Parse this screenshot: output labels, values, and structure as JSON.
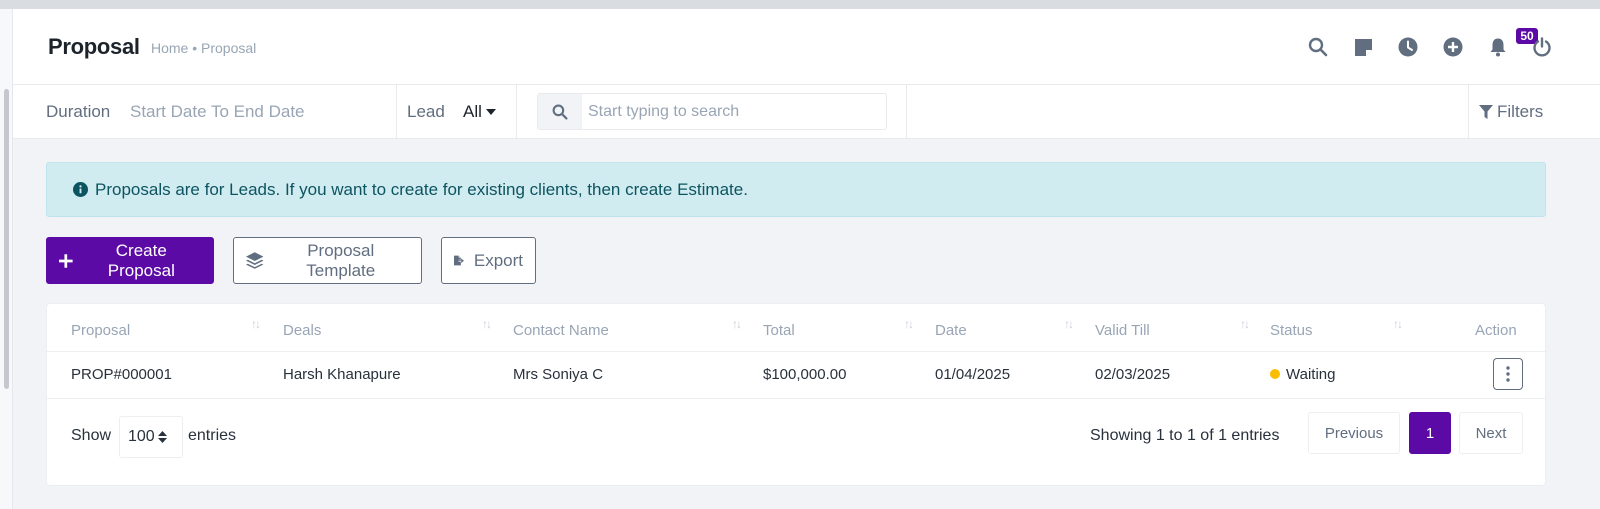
{
  "header": {
    "title": "Proposal",
    "breadcrumb": "Home • Proposal",
    "notification_count": "50"
  },
  "filters": {
    "duration_label": "Duration",
    "duration_value": "Start Date To End Date",
    "lead_label": "Lead",
    "lead_value": "All",
    "search_placeholder": "Start typing to search",
    "filters_label": "Filters"
  },
  "alert": {
    "text": "Proposals are for Leads. If you want to create for existing clients, then create Estimate."
  },
  "actions": {
    "create_label": "Create Proposal",
    "template_label": "Proposal Template",
    "export_label": "Export"
  },
  "table": {
    "columns": [
      "Proposal",
      "Deals",
      "Contact Name",
      "Total",
      "Date",
      "Valid Till",
      "Status",
      "Action"
    ],
    "rows": [
      {
        "proposal": "PROP#000001",
        "deal": "Harsh Khanapure",
        "contact": "Mrs Soniya C",
        "total": "$100,000.00",
        "date": "01/04/2025",
        "valid_till": "02/03/2025",
        "status": "Waiting",
        "status_color": "#fcbd01"
      }
    ]
  },
  "footer": {
    "show_label": "Show",
    "page_size": "100",
    "entries_label": "entries",
    "info": "Showing 1 to 1 of 1 entries",
    "previous": "Previous",
    "current_page": "1",
    "next": "Next"
  },
  "colors": {
    "brand": "#5b0aa5",
    "alert_bg": "#d1ecf1",
    "status_waiting": "#fcbd01"
  },
  "icons": [
    "search-icon",
    "sticky-note-icon",
    "clock-icon",
    "plus-circle-icon",
    "bell-icon",
    "power-icon",
    "filter-icon",
    "info-icon",
    "plus-icon",
    "layers-icon",
    "file-export-icon",
    "kebab-icon",
    "caret-down-icon",
    "sort-icon"
  ]
}
